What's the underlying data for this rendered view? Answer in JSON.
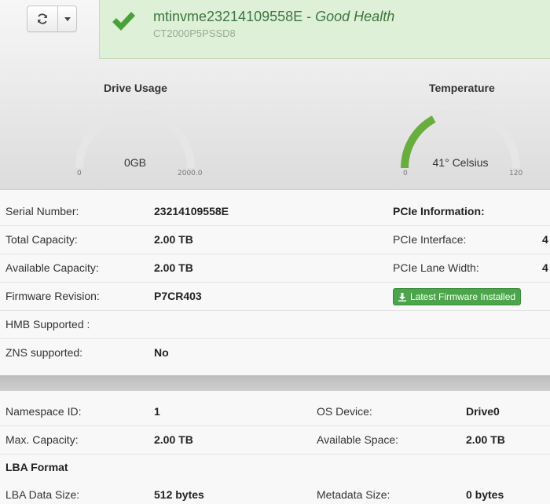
{
  "toolbar": {
    "refresh_icon": "refresh-icon",
    "caret_icon": "caret-down-icon"
  },
  "health": {
    "device_name": "mtinvme23214109558E",
    "separator": " - ",
    "status": "Good Health",
    "model": "CT2000P5PSSD8",
    "color": "#3c763d"
  },
  "gauges": {
    "usage": {
      "title": "Drive Usage",
      "value": "0GB",
      "min": "0",
      "max": "2000.0",
      "fraction": 0.0
    },
    "temperature": {
      "title": "Temperature",
      "value": "41° Celsius",
      "min": "0",
      "max": "120",
      "fraction": 0.3417,
      "color": "#6aad3f"
    }
  },
  "drive_info": [
    {
      "label": "Serial Number:",
      "value": "23214109558E"
    },
    {
      "label": "Total Capacity:",
      "value": "2.00 TB"
    },
    {
      "label": "Available Capacity:",
      "value": "2.00 TB"
    },
    {
      "label": "Firmware Revision:",
      "value": "P7CR403"
    },
    {
      "label": "HMB Supported :",
      "value": ""
    },
    {
      "label": "ZNS supported:",
      "value": "No"
    }
  ],
  "pcie": {
    "heading": "PCIe Information:",
    "interface_label": "PCIe Interface:",
    "interface_value": "4",
    "lane_label": "PCIe Lane Width:",
    "lane_value": "4",
    "firmware_button": "Latest Firmware Installed",
    "firmware_button_color": "#4ba54a"
  },
  "namespace": {
    "id_label": "Namespace ID:",
    "id_value": "1",
    "os_label": "OS Device:",
    "os_value": "Drive0",
    "max_label": "Max. Capacity:",
    "max_value": "2.00 TB",
    "avail_label": "Available Space:",
    "avail_value": "2.00 TB",
    "lba_heading": "LBA Format",
    "lba_size_label": "LBA Data Size:",
    "lba_size_value": "512 bytes",
    "meta_label": "Metadata Size:",
    "meta_value": "0 bytes"
  }
}
